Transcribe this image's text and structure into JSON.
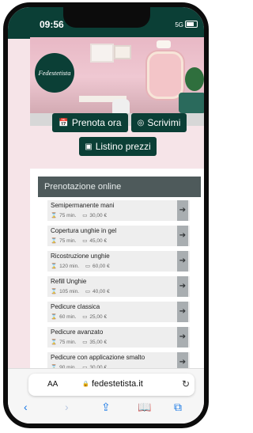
{
  "status_bar": {
    "time": "09:56",
    "network": "5G"
  },
  "hero": {
    "logo_text": "Fedestetista"
  },
  "buttons": {
    "prenota": "Prenota ora",
    "scrivimi": "Scrivimi",
    "listino": "Listino prezzi"
  },
  "booking": {
    "title": "Prenotazione online",
    "services": [
      {
        "name": "Semipermanente mani",
        "duration": "75 min.",
        "price": "30,00 €"
      },
      {
        "name": "Copertura unghie in gel",
        "duration": "75 min.",
        "price": "45,00 €"
      },
      {
        "name": "Ricostruzione unghie",
        "duration": "120 min.",
        "price": "60,00 €"
      },
      {
        "name": "Refill Unghie",
        "duration": "105 min.",
        "price": "40,00 €"
      },
      {
        "name": "Pedicure classica",
        "duration": "60 min.",
        "price": "25,00 €"
      },
      {
        "name": "Pedicure avanzato",
        "duration": "75 min.",
        "price": "35,00 €"
      },
      {
        "name": "Pedicure con applicazione smalto",
        "duration": "90 min.",
        "price": "30,00 €"
      }
    ]
  },
  "browser": {
    "aa": "AA",
    "url": "fedestetista.it"
  },
  "icons": {
    "calendar": "calendar-icon",
    "whatsapp": "whatsapp-icon",
    "pricelist": "pricelist-icon",
    "hourglass": "hourglass-icon",
    "money": "money-icon",
    "arrow": "arrow-right-icon",
    "colors": {
      "brand": "#0b3f36",
      "header": "#4e5a5b",
      "safari_blue": "#1677e5"
    }
  }
}
